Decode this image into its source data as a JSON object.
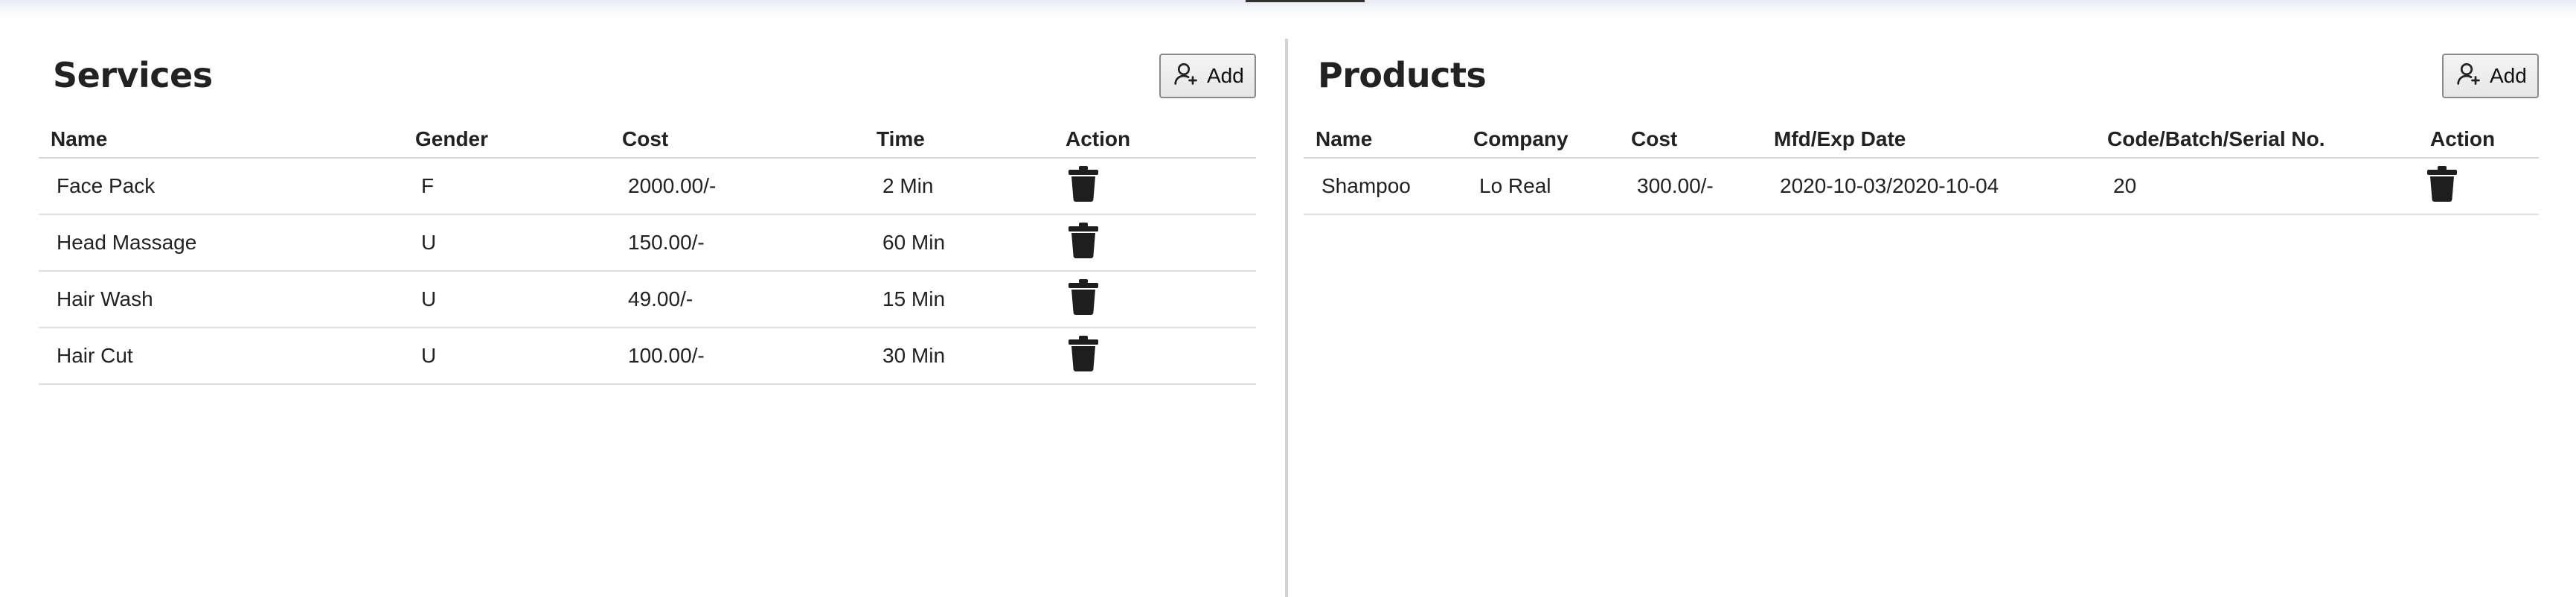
{
  "services": {
    "title": "Services",
    "add_label": "Add",
    "columns": [
      "Name",
      "Gender",
      "Cost",
      "Time",
      "Action"
    ],
    "rows": [
      {
        "name": "Face Pack",
        "gender": "F",
        "cost": "2000.00/-",
        "time": "2 Min"
      },
      {
        "name": "Head Massage",
        "gender": "U",
        "cost": "150.00/-",
        "time": "60 Min"
      },
      {
        "name": "Hair Wash",
        "gender": "U",
        "cost": "49.00/-",
        "time": "15 Min"
      },
      {
        "name": "Hair Cut",
        "gender": "U",
        "cost": "100.00/-",
        "time": "30 Min"
      }
    ]
  },
  "products": {
    "title": "Products",
    "add_label": "Add",
    "columns": [
      "Name",
      "Company",
      "Cost",
      "Mfd/Exp Date",
      "Code/Batch/Serial No.",
      "Action"
    ],
    "rows": [
      {
        "name": "Shampoo",
        "company": "Lo Real",
        "cost": "300.00/-",
        "mfd_exp": "2020-10-03/2020-10-04",
        "code": "20"
      }
    ]
  },
  "icons": {
    "add": "add-user-icon",
    "delete": "trash-icon"
  }
}
